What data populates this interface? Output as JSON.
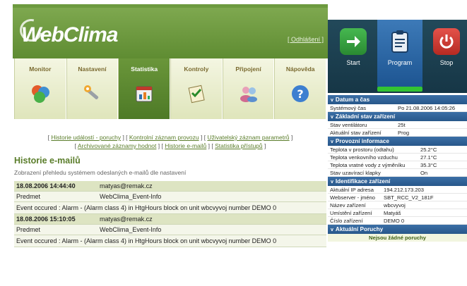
{
  "app": {
    "logo": "WebClima",
    "logout": "[ Odhlášení ]"
  },
  "nav": [
    {
      "label": "Monitor",
      "icon": "globe-icon"
    },
    {
      "label": "Nastavení",
      "icon": "wrench-icon"
    },
    {
      "label": "Statistika",
      "icon": "calendar-chart-icon",
      "active": true
    },
    {
      "label": "Kontroly",
      "icon": "checklist-icon"
    },
    {
      "label": "Připojení",
      "icon": "users-icon"
    },
    {
      "label": "Nápověda",
      "icon": "help-icon"
    }
  ],
  "breadcrumb_links": [
    "Historie událostí - poruchy",
    "Kontrolní záznam provozu",
    "Uživatelský záznam parametrů",
    "Archivované záznamy hodnot",
    "Historie e-mailů",
    "Statistika přístupů"
  ],
  "section": {
    "title": "Historie e-mailů",
    "subtitle": "Zobrazení přehledu systémem odeslaných e-mailů dle nastavení"
  },
  "emails": [
    {
      "datetime": "18.08.2006 14:44:40",
      "to": "matyas@remak.cz",
      "subject_label": "Predmet",
      "subject": "WebClima_Event-Info",
      "body": "Event occured : Alarm - (Alarm class 4) in HtgHours block on unit wbcvyvoj number DEMO 0"
    },
    {
      "datetime": "18.08.2006 15:10:05",
      "to": "matyas@remak.cz",
      "subject_label": "Predmet",
      "subject": "WebClima_Event-Info",
      "body": "Event occured : Alarm - (Alarm class 4) in HtgHours block on unit wbcvyvoj number DEMO 0"
    }
  ],
  "panel": {
    "buttons": [
      {
        "label": "Start",
        "icon": "arrow-right-icon",
        "color": "#2f9d3a"
      },
      {
        "label": "Program",
        "icon": "clipboard-icon",
        "color": "#2f6fae"
      },
      {
        "label": "Stop",
        "icon": "power-icon",
        "color": "#d23a2a"
      }
    ],
    "sections": [
      {
        "title": "Datum a čas",
        "rows": [
          {
            "label": "Systémový čas",
            "value": "Po 21.08.2006 14:05:26"
          }
        ]
      },
      {
        "title": "Základní stav zařízení",
        "rows": [
          {
            "label": "Stav ventilátoru",
            "value": "25t"
          },
          {
            "label": "Aktuální stav zařízení",
            "value": "Prog"
          }
        ]
      },
      {
        "title": "Provozní informace",
        "rows": [
          {
            "label": "Teplota v prostoru (odtahu)",
            "value": "25.2°C"
          },
          {
            "label": "Teplota venkovního vzduchu",
            "value": "27.1°C"
          },
          {
            "label": "Teplota vratné vody z výměníku",
            "value": "35.3°C"
          },
          {
            "label": "Stav uzavírací klapky",
            "value": "On"
          }
        ]
      },
      {
        "title": "Identifikace zařízení",
        "rows": [
          {
            "label": "Aktuální IP adresa",
            "value": "194.212.173.203"
          },
          {
            "label": "Webserver - jméno",
            "value": "SBT_RCC_V2_181F"
          },
          {
            "label": "Název zařízení",
            "value": "wbcvyvoj"
          },
          {
            "label": "Umístění zařízení",
            "value": "Matyáš"
          },
          {
            "label": "Číslo zařízení",
            "value": "DEMO 0"
          }
        ]
      },
      {
        "title": "Aktuální Poruchy",
        "note": "Nejsou žádné poruchy"
      }
    ]
  }
}
